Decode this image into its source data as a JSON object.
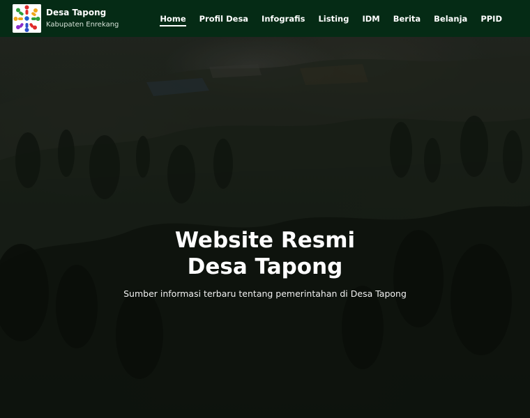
{
  "header": {
    "title": "Desa Tapong",
    "subtitle": "Kabupaten Enrekang",
    "logo_icon": "village-logo-icon"
  },
  "nav": {
    "items": [
      {
        "label": "Home",
        "active": true
      },
      {
        "label": "Profil Desa",
        "active": false
      },
      {
        "label": "Infografis",
        "active": false
      },
      {
        "label": "Listing",
        "active": false
      },
      {
        "label": "IDM",
        "active": false
      },
      {
        "label": "Berita",
        "active": false
      },
      {
        "label": "Belanja",
        "active": false
      },
      {
        "label": "PPID",
        "active": false
      }
    ]
  },
  "hero": {
    "title_line1": "Website Resmi",
    "title_line2": "Desa Tapong",
    "subtitle": "Sumber informasi terbaru tentang pemerintahan di Desa Tapong"
  },
  "colors": {
    "navbar_bg": "#052b15",
    "hero_overlay": "#111611",
    "text": "#ffffff"
  }
}
